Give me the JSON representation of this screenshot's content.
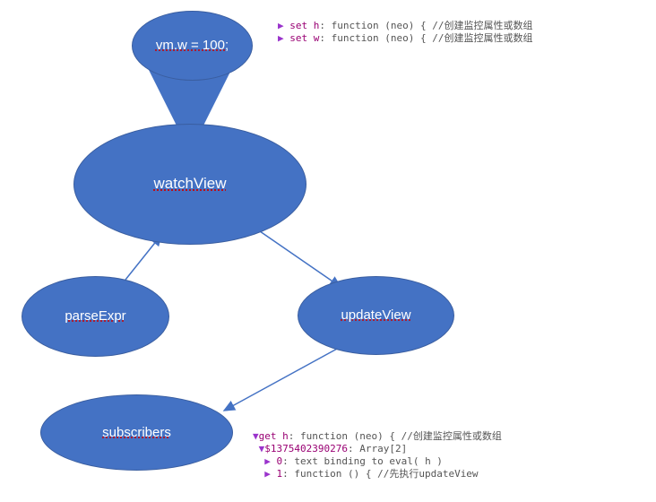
{
  "nodes": {
    "top": {
      "label": "vm.w = 100;"
    },
    "watchView": {
      "label": "watchView"
    },
    "parseExpr": {
      "label": "parseExpr"
    },
    "updateView": {
      "label": "updateView"
    },
    "subscribers": {
      "label": "subscribers"
    }
  },
  "code_top": {
    "line1_prefix": "▶ ",
    "line1_kw": "set h",
    "line1_rest": ": function (neo) { //创建监控属性或数组",
    "line2_prefix": "▶ ",
    "line2_kw": "set w",
    "line2_rest": ": function (neo) { //创建监控属性或数组"
  },
  "code_bottom": {
    "l1_prefix": "▼",
    "l1_kw": "get h",
    "l1_rest": ": function (neo) { //创建监控属性或数组",
    "l2_prefix": " ▼",
    "l2_kw": "$1375402390276",
    "l2_rest": ": Array[2]",
    "l3_prefix": "  ▶ ",
    "l3_kw": "0",
    "l3_rest": ": text binding to eval( h )",
    "l4_prefix": "  ▶ ",
    "l4_kw": "1",
    "l4_rest": ": function () { //先执行updateView"
  }
}
